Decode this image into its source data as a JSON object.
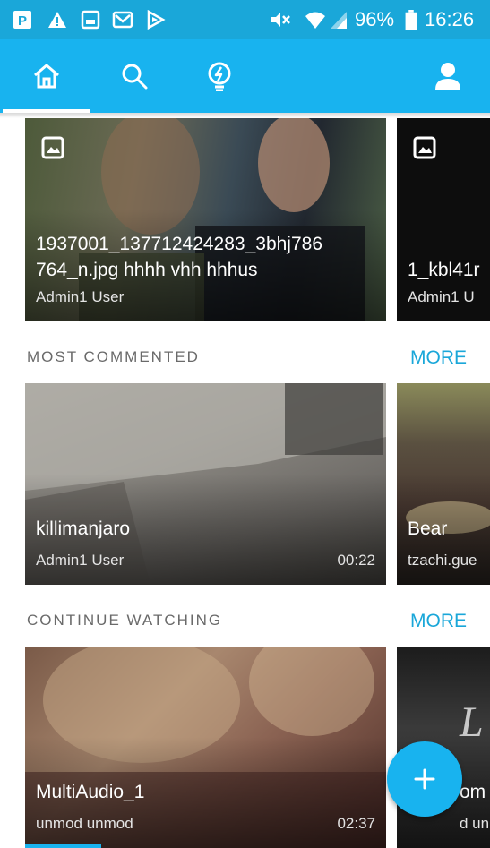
{
  "status_bar": {
    "battery": "96%",
    "time": "16:26",
    "left_icons": [
      "p-app-icon",
      "warning-icon",
      "image-icon",
      "mail-icon",
      "flag-icon"
    ],
    "right_icons": [
      "mute-icon",
      "wifi-icon",
      "signal-icon",
      "battery-icon"
    ]
  },
  "toolbar": {
    "tabs": [
      "home-icon",
      "search-icon",
      "lightbulb-icon"
    ],
    "active_tab": "home-icon",
    "profile_icon": "user-icon"
  },
  "featured": {
    "cards": [
      {
        "title": "1937001_137712424283_3bhj786 764_n.jpg hhhh vhh hhhus",
        "author": "Admin1 User",
        "badge": "image-icon"
      },
      {
        "title": "1_kbl41r",
        "author": "Admin1 U",
        "badge": "image-icon"
      }
    ]
  },
  "most_commented": {
    "heading": "MOST COMMENTED",
    "more": "MORE",
    "cards": [
      {
        "title": "killimanjaro",
        "author": "Admin1 User",
        "duration": "00:22"
      },
      {
        "title": "Bear",
        "author": "tzachi.gue"
      }
    ]
  },
  "continue_watching": {
    "heading": "CONTINUE WATCHING",
    "more": "MORE",
    "cards": [
      {
        "title": "MultiAudio_1",
        "author": "unmod unmod",
        "duration": "02:37",
        "progress": 0.21
      },
      {
        "title": "om",
        "author": "d un"
      }
    ]
  },
  "fab": {
    "label": "+",
    "icon": "add-icon"
  },
  "colors": {
    "accent": "#18b3ef",
    "status_bar": "#1aa7d9",
    "more_link": "#1aa7d9"
  }
}
